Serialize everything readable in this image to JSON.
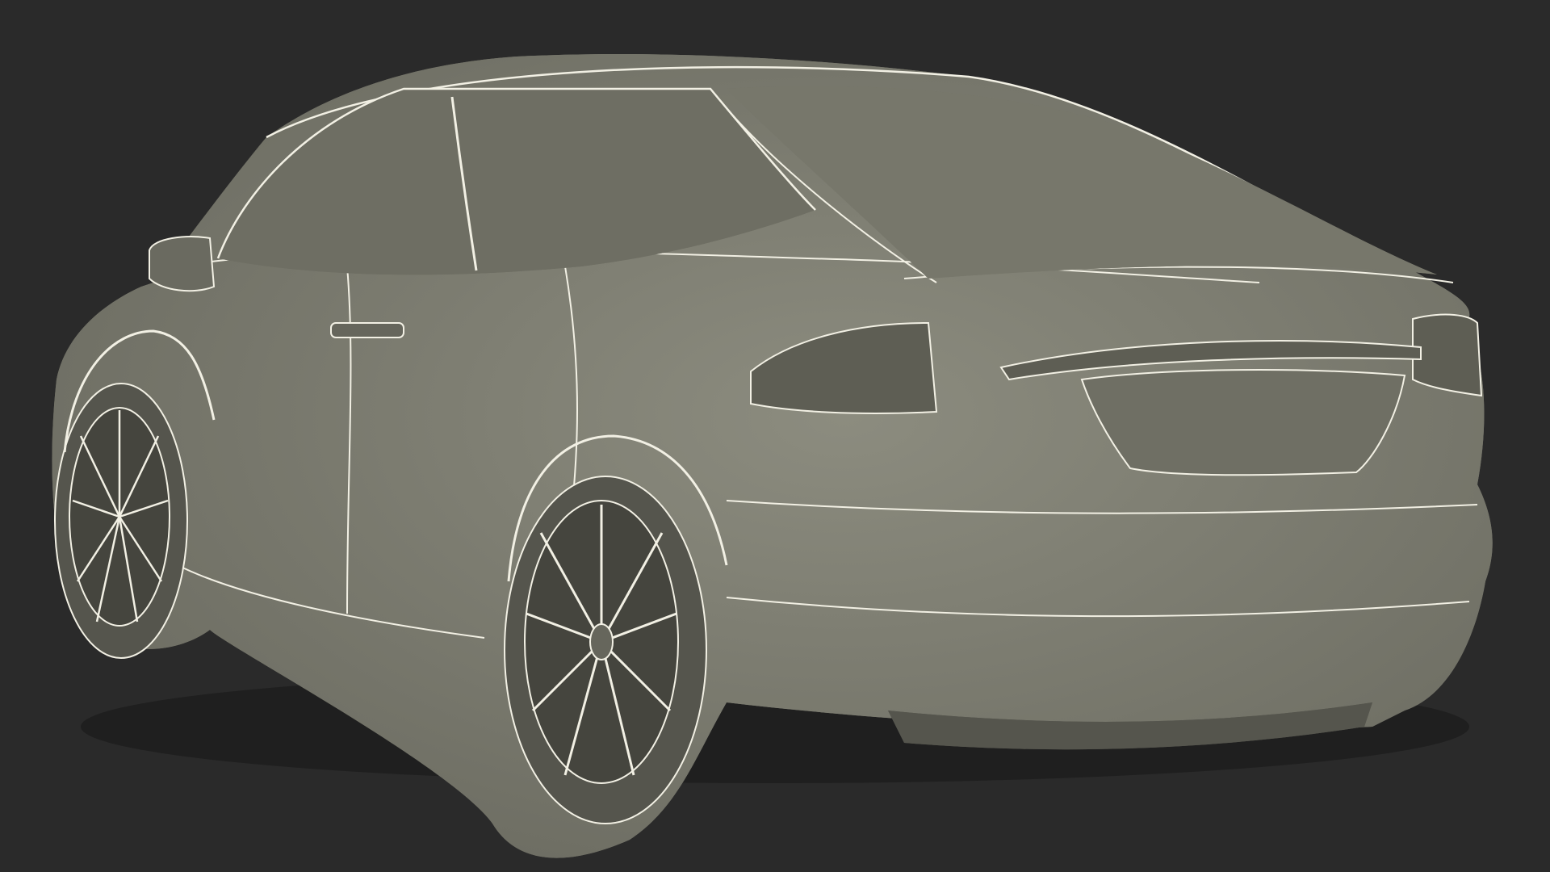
{
  "scene": {
    "subject": "car-wireframe",
    "colors": {
      "background": "#2a2a2a",
      "body_shade": "#7d7d70",
      "body_light": "#8c8c7f",
      "body_dark": "#5e5e54",
      "glass": "#6e6e63",
      "wire": "#f2f0e4",
      "tire": "#55554d",
      "rim_shadow": "#45453e"
    }
  }
}
